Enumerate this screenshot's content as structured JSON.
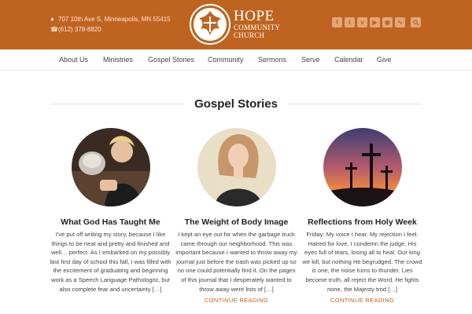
{
  "contact": {
    "address": "707 10th Ave S, Minneapolis, MN 55415",
    "phone": "(612) 378-8820"
  },
  "logo": {
    "line1": "HOPE",
    "line2": "COMMUNITY",
    "line3": "CHURCH"
  },
  "social_icons": [
    "facebook-icon",
    "twitter-icon",
    "vimeo-icon",
    "youtube-icon",
    "instagram-icon",
    "rss-icon"
  ],
  "nav": {
    "items": [
      {
        "label": "About Us"
      },
      {
        "label": "Ministries"
      },
      {
        "label": "Gospel Stories"
      },
      {
        "label": "Community"
      },
      {
        "label": "Sermons"
      },
      {
        "label": "Serve"
      },
      {
        "label": "Calendar"
      },
      {
        "label": "Give"
      }
    ]
  },
  "section": {
    "title": "Gospel Stories"
  },
  "posts": [
    {
      "title": "What God Has Taught Me",
      "excerpt": "I've put off writing my story, because I like things to be neat and pretty and finished and well… perfect. As I embarked on my possibly last first day of school this fall, I was filled with the excitement of graduating  and beginning work as a Speech Language Pathologist, but also complete fear and uncertainty […]",
      "more": ""
    },
    {
      "title": "The Weight of Body Image",
      "excerpt": "I kept an eye out for when the garbage truck came through our neighborhood. This was important because I wanted to throw away my journal just before the trash was picked up so no one could potentially find it. On the pages of this journal that I desperately wanted to throw away were lists of […]",
      "more": "CONTINUE READING"
    },
    {
      "title": "Reflections from Holy Week",
      "excerpt": "Friday: My voice I hear. My rejection I feel. Hatred for love, I condemn the judge. His eyes full of tears, losing all to heal. Our king we kill, but nothing He begrudged. The crowd is one, the noise turns to thunder. Lies become truth, all reject the Word. He fights none, the Majesty trod […]",
      "more": "CONTINUE READING"
    }
  ],
  "colors": {
    "brand": "#bf6420",
    "nav_text": "#444444",
    "link": "#bf6420"
  }
}
